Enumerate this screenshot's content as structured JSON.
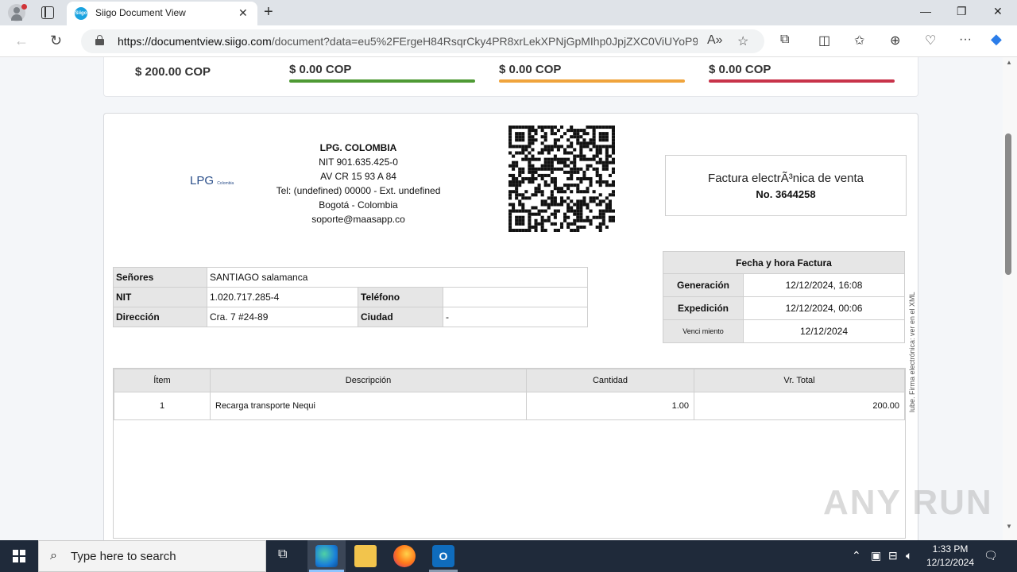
{
  "browser": {
    "tab_title": "Siigo Document View",
    "tab_favicon_text": "Siigo",
    "url_host": "https://documentview.siigo.com",
    "url_path": "/document?data=eu5%2FErgeH84RsqrCky4PR8xrLekXPNjGpMIhp0JpjZXC0ViUYoP9Z...",
    "icons": [
      "profile-icon",
      "tab-actions-icon",
      "new-tab-icon",
      "minimize-icon",
      "maximize-icon",
      "close-icon",
      "back-icon",
      "refresh-icon",
      "lock-icon",
      "read-aloud-icon",
      "favorite-icon",
      "extensions-icon",
      "split-screen-icon",
      "favorites-icon",
      "collections-icon",
      "performance-icon",
      "more-icon",
      "copilot-icon"
    ]
  },
  "summary": {
    "amounts": [
      "$ 200.00 COP",
      "$ 0.00 COP",
      "$ 0.00 COP",
      "$ 0.00 COP"
    ],
    "bar_colors": [
      "#4e9a34",
      "#f0a43c",
      "#c8334a"
    ]
  },
  "company": {
    "logo_text": "LPG",
    "logo_sub": "Colombia",
    "name": "LPG. COLOMBIA",
    "nit": "NIT 901.635.425-0",
    "address": "AV CR 15 93 A 84",
    "phone": "Tel: (undefined) 00000 - Ext. undefined",
    "city": "Bogotá - Colombia",
    "email": "soporte@maasapp.co"
  },
  "invoice": {
    "type": "Factura electrÃ³nica de venta",
    "number": "No. 3644258"
  },
  "client": {
    "senores_label": "Señores",
    "senores": "SANTIAGO salamanca",
    "nit_label": "NIT",
    "nit": "1.020.717.285-4",
    "telefono_label": "Teléfono",
    "telefono": "",
    "direccion_label": "Dirección",
    "direccion": "Cra. 7 #24-89",
    "ciudad_label": "Ciudad",
    "ciudad": "-"
  },
  "dates": {
    "header": "Fecha y hora Factura",
    "generacion_label": "Generación",
    "generacion": "12/12/2024, 16:08",
    "expedicion_label": "Expedición",
    "expedicion": "12/12/2024, 00:06",
    "vencimiento_label": "Venci miento",
    "vencimiento": "12/12/2024"
  },
  "items": {
    "headers": [
      "Ítem",
      "Descripción",
      "Cantidad",
      "Vr. Total"
    ],
    "rows": [
      [
        "1",
        "Recarga transporte Nequi",
        "1.00",
        "200.00"
      ]
    ]
  },
  "side_text": "lube. Firma electrónica: ver en el XML",
  "watermark": "ANY RUN",
  "taskbar": {
    "search_placeholder": "Type here to search",
    "time": "1:33 PM",
    "date": "12/12/2024"
  }
}
